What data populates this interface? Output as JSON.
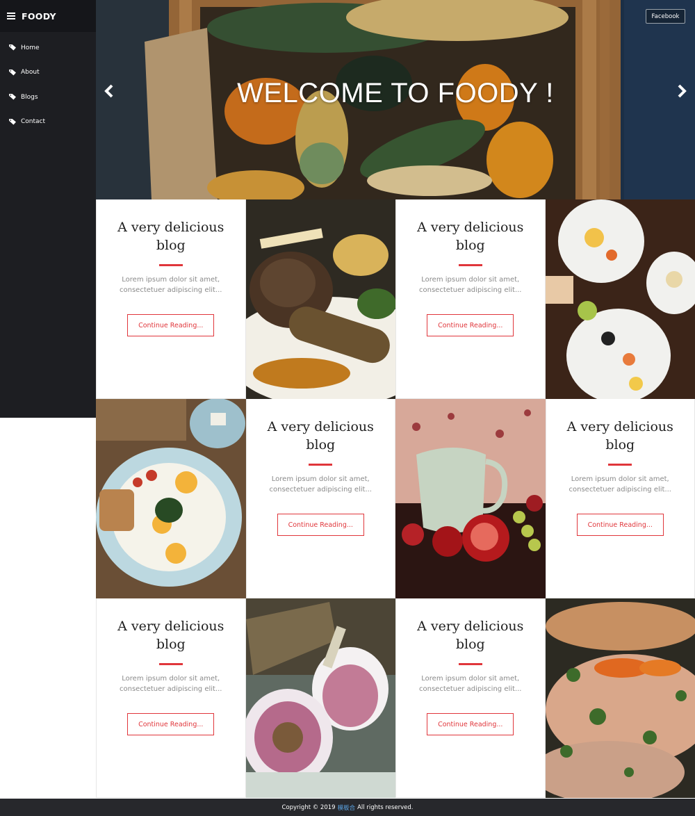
{
  "brand": {
    "title": "FOODY"
  },
  "nav": [
    {
      "label": "Home"
    },
    {
      "label": "About"
    },
    {
      "label": "Blogs"
    },
    {
      "label": "Contact"
    }
  ],
  "hero": {
    "title": "WELCOME TO FOODY !",
    "facebook_label": "Facebook"
  },
  "cards": [
    {
      "title": "A very delicious blog",
      "text": "Lorem ipsum dolor sit amet, consectetuer adipiscing elit...",
      "button": "Continue Reading..."
    },
    {
      "title": "A very delicious blog",
      "text": "Lorem ipsum dolor sit amet, consectetuer adipiscing elit...",
      "button": "Continue Reading..."
    },
    {
      "title": "A very delicious blog",
      "text": "Lorem ipsum dolor sit amet, consectetuer adipiscing elit...",
      "button": "Continue Reading..."
    },
    {
      "title": "A very delicious blog",
      "text": "Lorem ipsum dolor sit amet, consectetuer adipiscing elit...",
      "button": "Continue Reading..."
    },
    {
      "title": "A very delicious blog",
      "text": "Lorem ipsum dolor sit amet, consectetuer adipiscing elit...",
      "button": "Continue Reading..."
    },
    {
      "title": "A very delicious blog",
      "text": "Lorem ipsum dolor sit amet, consectetuer adipiscing elit...",
      "button": "Continue Reading..."
    }
  ],
  "footer": {
    "prefix": "Copyright © 2019",
    "link": "模板合",
    "suffix": "All rights reserved."
  },
  "colors": {
    "accent": "#e0363b",
    "sidebar": "#1d1e22",
    "footer": "#27282c"
  }
}
